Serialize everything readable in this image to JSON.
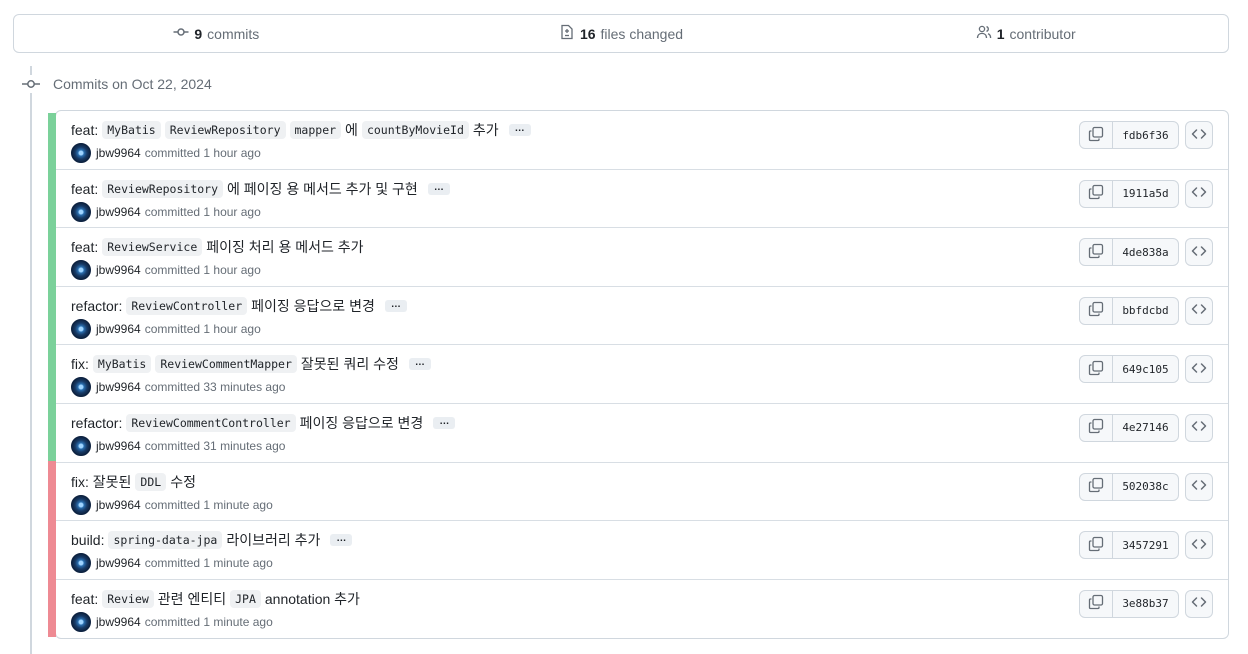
{
  "summary": {
    "commits_count": "9",
    "commits_label": "commits",
    "files_count": "16",
    "files_label": "files changed",
    "contributors_count": "1",
    "contributors_label": "contributor"
  },
  "timeline": {
    "title": "Commits on Oct 22, 2024"
  },
  "colors": {
    "stripe_green": "#7bd19a",
    "stripe_red": "#ee8a93"
  },
  "commits": [
    {
      "parts": [
        [
          "t",
          "feat: "
        ],
        [
          "c",
          "MyBatis"
        ],
        [
          "c",
          "ReviewRepository"
        ],
        [
          "c",
          "mapper"
        ],
        [
          "t",
          " 에 "
        ],
        [
          "c",
          "countByMovieId"
        ],
        [
          "t",
          " 추가"
        ]
      ],
      "ellipsis": "…",
      "author": "jbw9964",
      "time": "committed 1 hour ago",
      "sha": "fdb6f36"
    },
    {
      "parts": [
        [
          "t",
          "feat: "
        ],
        [
          "c",
          "ReviewRepository"
        ],
        [
          "t",
          " 에 페이징 용 메서드 추가 및 구현"
        ]
      ],
      "ellipsis": "…",
      "author": "jbw9964",
      "time": "committed 1 hour ago",
      "sha": "1911a5d"
    },
    {
      "parts": [
        [
          "t",
          "feat: "
        ],
        [
          "c",
          "ReviewService"
        ],
        [
          "t",
          " 페이징 처리 용 메서드 추가"
        ]
      ],
      "ellipsis": "",
      "author": "jbw9964",
      "time": "committed 1 hour ago",
      "sha": "4de838a"
    },
    {
      "parts": [
        [
          "t",
          "refactor: "
        ],
        [
          "c",
          "ReviewController"
        ],
        [
          "t",
          " 페이징 응답으로 변경"
        ]
      ],
      "ellipsis": "…",
      "author": "jbw9964",
      "time": "committed 1 hour ago",
      "sha": "bbfdcbd"
    },
    {
      "parts": [
        [
          "t",
          "fix: "
        ],
        [
          "c",
          "MyBatis"
        ],
        [
          "c",
          "ReviewCommentMapper"
        ],
        [
          "t",
          " 잘못된 쿼리 수정"
        ]
      ],
      "ellipsis": "…",
      "author": "jbw9964",
      "time": "committed 33 minutes ago",
      "sha": "649c105"
    },
    {
      "parts": [
        [
          "t",
          "refactor: "
        ],
        [
          "c",
          "ReviewCommentController"
        ],
        [
          "t",
          " 페이징 응답으로 변경"
        ]
      ],
      "ellipsis": "…",
      "author": "jbw9964",
      "time": "committed 31 minutes ago",
      "sha": "4e27146"
    },
    {
      "parts": [
        [
          "t",
          "fix: 잘못된 "
        ],
        [
          "c",
          "DDL"
        ],
        [
          "t",
          " 수정"
        ]
      ],
      "ellipsis": "",
      "author": "jbw9964",
      "time": "committed 1 minute ago",
      "sha": "502038c"
    },
    {
      "parts": [
        [
          "t",
          "build: "
        ],
        [
          "c",
          "spring-data-jpa"
        ],
        [
          "t",
          " 라이브러리 추가"
        ]
      ],
      "ellipsis": "…",
      "author": "jbw9964",
      "time": "committed 1 minute ago",
      "sha": "3457291"
    },
    {
      "parts": [
        [
          "t",
          "feat: "
        ],
        [
          "c",
          "Review"
        ],
        [
          "t",
          " 관련 엔티티 "
        ],
        [
          "c",
          "JPA"
        ],
        [
          "t",
          " annotation 추가"
        ]
      ],
      "ellipsis": "",
      "author": "jbw9964",
      "time": "committed 1 minute ago",
      "sha": "3e88b37"
    }
  ]
}
